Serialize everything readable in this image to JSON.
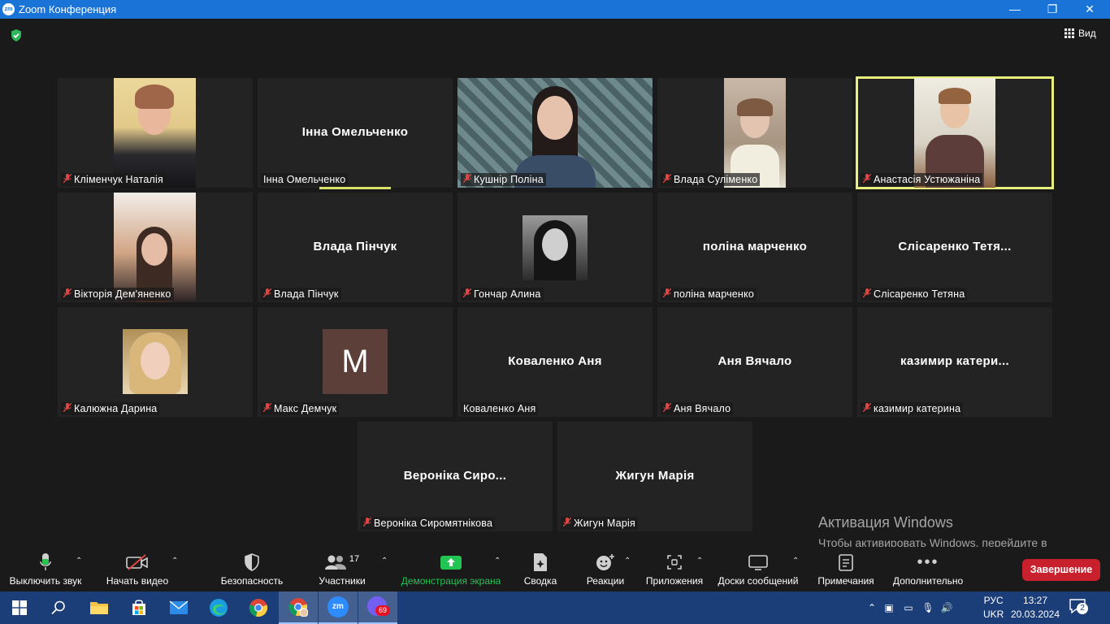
{
  "window": {
    "title": "Zoom Конференция",
    "minimize": "—",
    "maximize": "❐",
    "close": "✕"
  },
  "view_button": {
    "label": "Вид"
  },
  "tiles": [
    {
      "name": "Кліменчук Наталія",
      "big": "",
      "muted": true
    },
    {
      "name": "Інна Омельченко",
      "big": "Інна Омельченко",
      "muted": false
    },
    {
      "name": "Кушнір Поліна",
      "big": "",
      "muted": true
    },
    {
      "name": "Влада Суліменко",
      "big": "",
      "muted": true
    },
    {
      "name": "Анастасія Устюжаніна",
      "big": "",
      "muted": true
    },
    {
      "name": "Вікторія Дем'яненко",
      "big": "",
      "muted": true
    },
    {
      "name": "Влада Пінчук",
      "big": "Влада Пінчук",
      "muted": true
    },
    {
      "name": "Гончар Алина",
      "big": "",
      "muted": true
    },
    {
      "name": "поліна марченко",
      "big": "поліна марченко",
      "muted": true
    },
    {
      "name": "Слісаренко Тетяна",
      "big": "Слісаренко Тетя...",
      "muted": true
    },
    {
      "name": "Калюжна Дарина",
      "big": "",
      "muted": true
    },
    {
      "name": "Макс Демчук",
      "big": "",
      "muted": true,
      "avatar_letter": "M"
    },
    {
      "name": "Коваленко Аня",
      "big": "Коваленко Аня",
      "muted": false
    },
    {
      "name": "Аня Вячало",
      "big": "Аня Вячало",
      "muted": true
    },
    {
      "name": "казимир катерина",
      "big": "казимир катери...",
      "muted": true
    },
    {
      "name": "Вероніка Сиромятнікова",
      "big": "Вероніка Сиро...",
      "muted": true
    },
    {
      "name": "Жигун Марія",
      "big": "Жигун Марія",
      "muted": true
    }
  ],
  "toolbar": {
    "mute": "Выключить звук",
    "video": "Начать видео",
    "security": "Безопасность",
    "participants": "Участники",
    "participants_count": "17",
    "share": "Демонстрация экрана",
    "summary": "Сводка",
    "reactions": "Реакции",
    "apps": "Приложения",
    "whiteboards": "Доски сообщений",
    "notes": "Примечания",
    "more": "Дополнительно",
    "end": "Завершение"
  },
  "activation": {
    "title": "Активация Windows",
    "text": "Чтобы активировать Windows, перейдите в раздел \"Параметры\"."
  },
  "taskbar": {
    "viber_badge": "69",
    "lang": "РУС",
    "layout": "UKR",
    "time": "13:27",
    "date": "20.03.2024",
    "notifications": "2"
  },
  "colors": {
    "title_bar": "#1a74d8",
    "end_button": "#c8202c",
    "share_green": "#23c552",
    "active_speaker": "#e6f07a",
    "mute_red": "#e04545"
  }
}
